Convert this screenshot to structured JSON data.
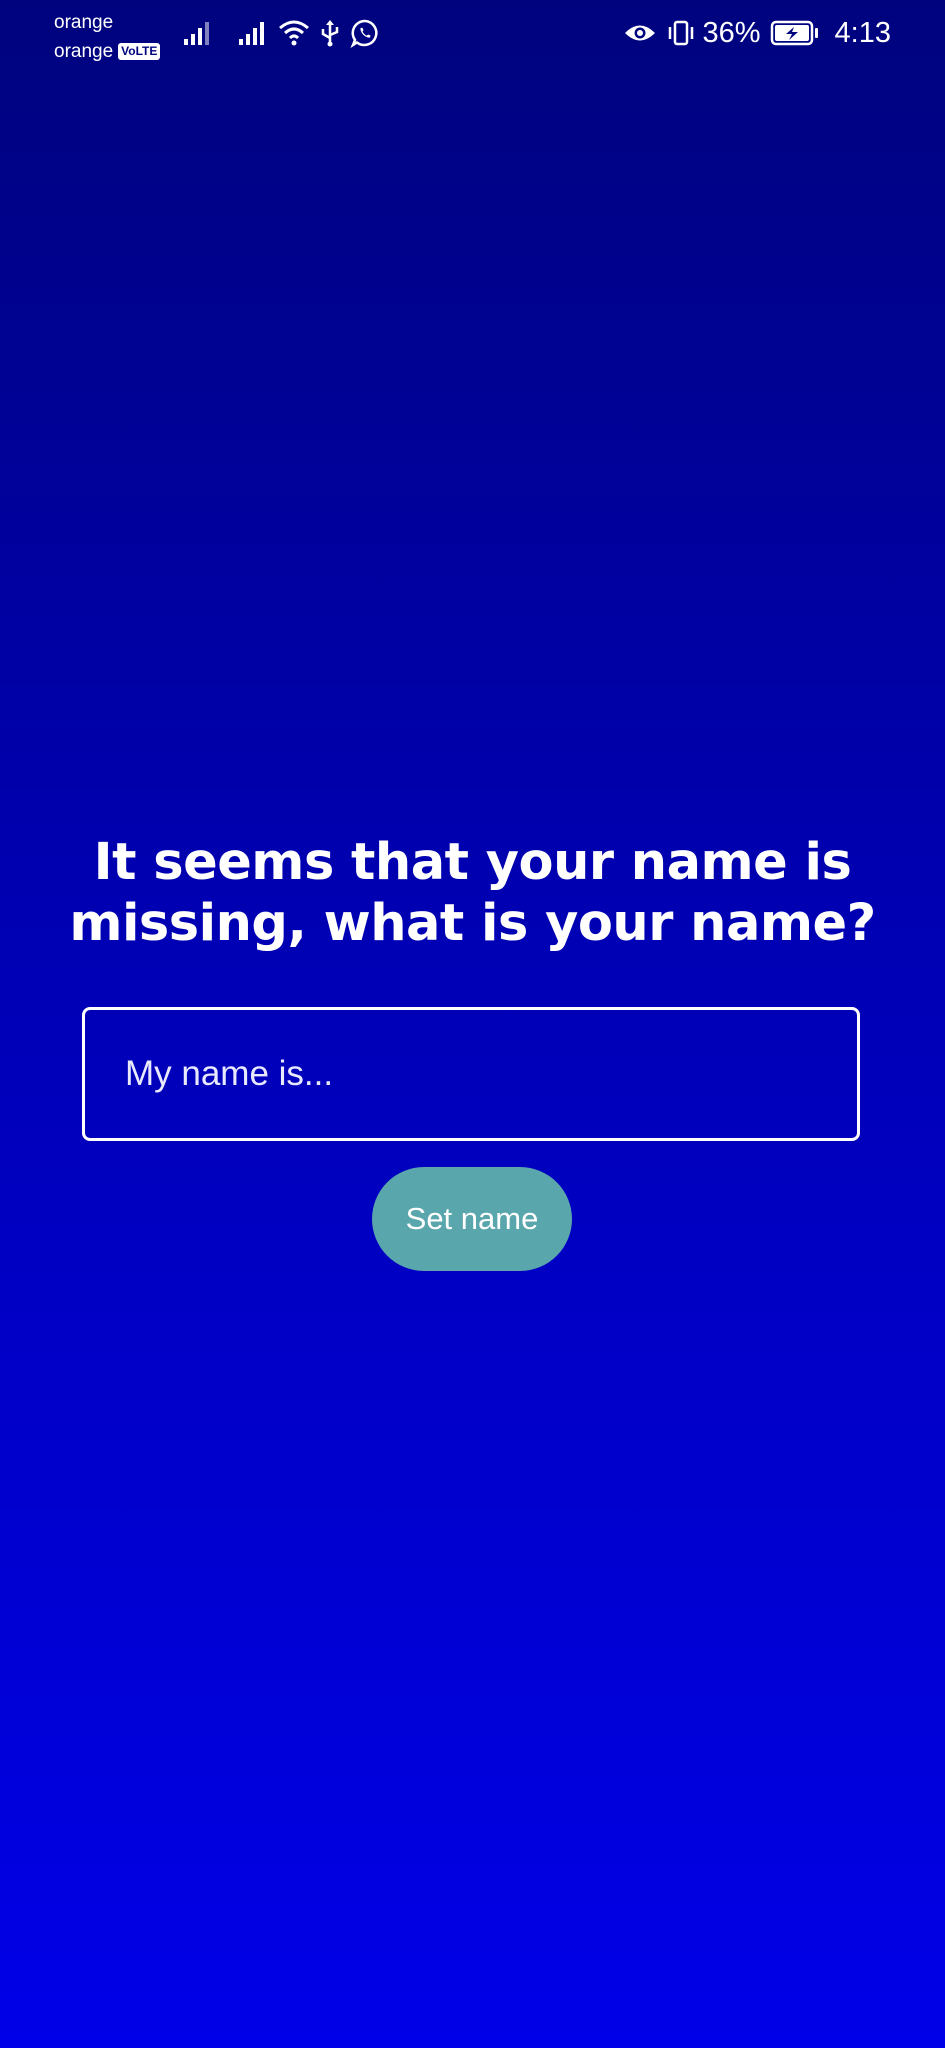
{
  "status_bar": {
    "carrier_1": "orange",
    "carrier_2": "orange",
    "volte_badge": "VoLTE",
    "battery_percent": "36%",
    "time": "4:13",
    "icons": [
      "signal-icon",
      "signal-icon",
      "wifi-icon",
      "usb-icon",
      "whatsapp-icon",
      "eye-icon",
      "vibrate-icon",
      "battery-charging-icon"
    ]
  },
  "main": {
    "title": "It seems that your name is missing, what is your name?",
    "name_input": {
      "placeholder": "My name is...",
      "value": ""
    },
    "set_name_button": "Set name"
  },
  "colors": {
    "background_top": "#00037e",
    "background_bottom": "#0000e8",
    "button": "#5aa6ad",
    "text": "#ffffff"
  }
}
